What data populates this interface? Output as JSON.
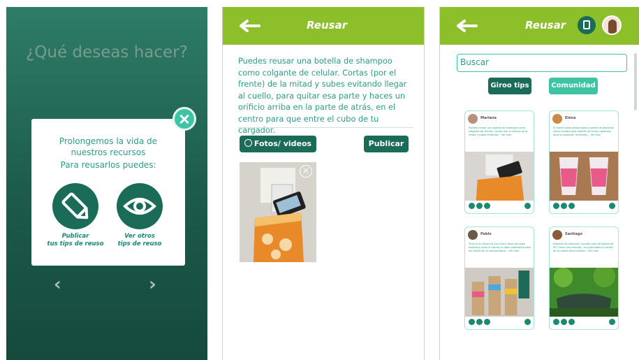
{
  "screen1": {
    "question": "¿Qué deseas hacer?",
    "modal": {
      "line1": "Prolongemos la vida de",
      "line2": "nuestros recursos",
      "line3": "Para reusarlos puedes:",
      "publish_label_1": "Publicar",
      "publish_label_2": "tus tips de reuso",
      "view_label_1": "Ver otros",
      "view_label_2": "tips de reuso"
    },
    "prev": "‹",
    "next": "›"
  },
  "screen2": {
    "title": "Reusar",
    "text": "Puedes reusar una botella de shampoo como colgante de celular. Cortas (por el frente) de la mitad y subes evitando llegar al cuello, para quitar esa parte y haces un orificio arriba en la parte de atrás, en el centro para que entre el cubo de tu cargador.",
    "photos_button": "Fotos/ videos",
    "publish_button": "Publicar"
  },
  "screen3": {
    "title": "Reusar",
    "search_value": "Buscar",
    "tab_giroo": "Giroo tips",
    "tab_comunidad": "Comunidad",
    "cards": [
      {
        "name": "Mariana",
        "text": "Puedes reusar una botella de shampoo como colgante de celular. Cortas (por el frente) de la mitad y subes evitando... Ver más"
      },
      {
        "name": "Elena",
        "text": "Si tienes vasos desechables puedes reutilizarlos como moldes para postres de fruta o gelatina, igual a quedarán increíbles... Ver más"
      },
      {
        "name": "Pablo",
        "text": "Yo lo di un segundo uso a mis tubos de papel higiénico como si fueran un lápiz ordenando para los cables de la computadora... Ver más"
      },
      {
        "name": "Santiago",
        "text": "Además de reforzarlo, puedes usar la botella de PET como una maceta, un invernadero a través de tu planta para hacerle... Ver más"
      }
    ]
  },
  "colors": {
    "header_green": "#8cbf2a",
    "teal_dark": "#1a6b58",
    "teal_light": "#3cc4a4"
  }
}
